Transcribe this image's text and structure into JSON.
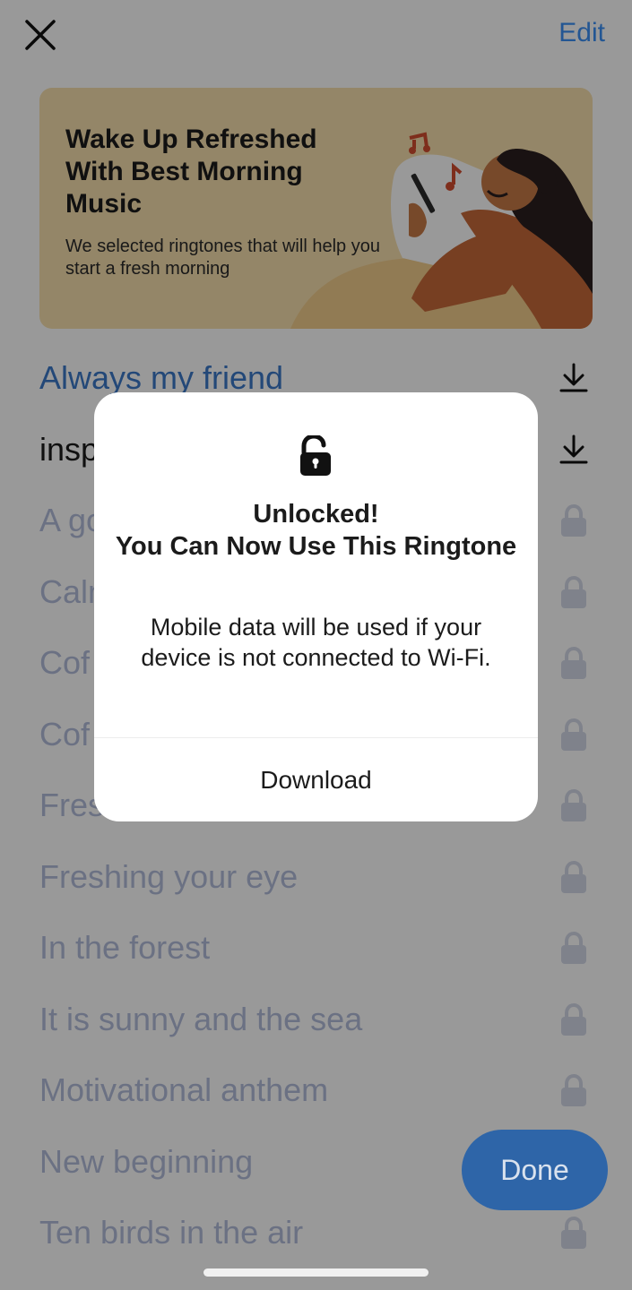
{
  "header": {
    "close_icon": "close-icon",
    "edit_label": "Edit"
  },
  "banner": {
    "title": "Wake Up Refreshed With Best Morning Music",
    "subtitle": "We selected ringtones that will help you start a fresh morning",
    "illustration": "woman-in-bed-listening-music-illustration"
  },
  "ringtones": [
    {
      "title": "Always my friend",
      "status": "download",
      "color": "#3b78c8"
    },
    {
      "title": "inspi",
      "status": "download",
      "color": "#1b1b1b"
    },
    {
      "title": "A go",
      "status": "locked",
      "color": "#b3bddb"
    },
    {
      "title": "Calm",
      "status": "locked",
      "color": "#b3bddb"
    },
    {
      "title": "Cof",
      "status": "locked",
      "color": "#b3bddb"
    },
    {
      "title": "Cof",
      "status": "locked",
      "color": "#b3bddb"
    },
    {
      "title": "Fres",
      "status": "locked",
      "color": "#b3bddb"
    },
    {
      "title": "Freshing your eye",
      "status": "locked",
      "color": "#b3bddb"
    },
    {
      "title": "In the forest",
      "status": "locked",
      "color": "#b3bddb"
    },
    {
      "title": "It is sunny and the sea",
      "status": "locked",
      "color": "#b3bddb"
    },
    {
      "title": "Motivational anthem",
      "status": "locked",
      "color": "#b3bddb"
    },
    {
      "title": "New beginning",
      "status": "locked",
      "color": "#b3bddb"
    },
    {
      "title": "Ten birds in the air",
      "status": "locked",
      "color": "#b3bddb"
    }
  ],
  "done_label": "Done",
  "dialog": {
    "icon": "unlocked-padlock-icon",
    "title": "Unlocked!\nYou Can Now Use This Ringtone",
    "message": "Mobile data will be used if your device is not connected to Wi-Fi.",
    "button_label": "Download"
  },
  "colors": {
    "accent": "#3b8ff5",
    "link_blue": "#3b78c8",
    "done_button": "#2e65a8",
    "banner_bg": "#f7dfae",
    "locked_text": "#b3bddb",
    "lock_icon": "#d4d9e8"
  }
}
